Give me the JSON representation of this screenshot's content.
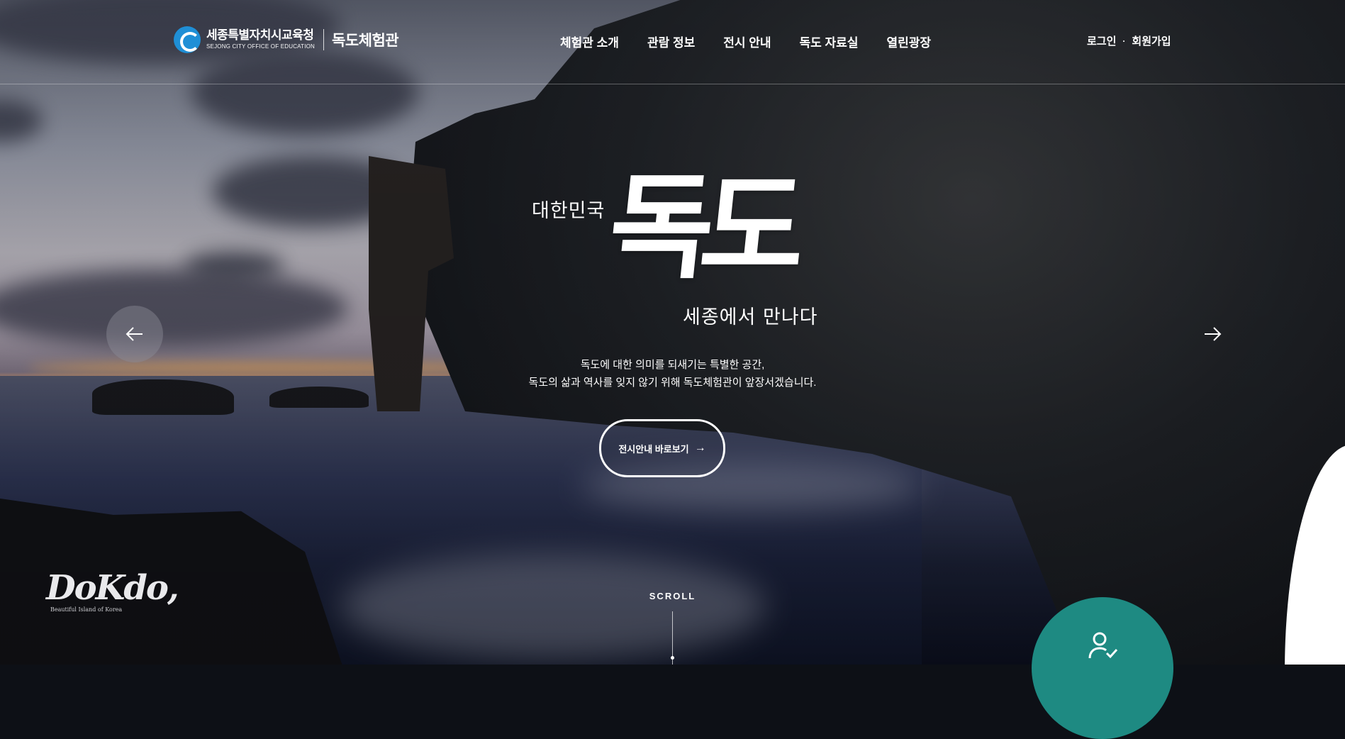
{
  "header": {
    "logo": {
      "org_name": "세종특별자치시교육청",
      "org_name_en": "SEJONG CITY OFFICE OF EDUCATION",
      "site_name": "독도체험관"
    },
    "nav": [
      {
        "label": "체험관 소개"
      },
      {
        "label": "관람 정보"
      },
      {
        "label": "전시 안내"
      },
      {
        "label": "독도 자료실"
      },
      {
        "label": "열린광장"
      }
    ],
    "util": {
      "login": "로그인",
      "separator": "·",
      "signup": "회원가입"
    }
  },
  "hero": {
    "pre_title": "대한민국",
    "title": "독도",
    "sub_title": "세종에서 만나다",
    "desc_line1": "독도에 대한 의미를 되새기는 특별한 공간,",
    "desc_line2": "독도의 삶과 역사를 잊지 않기 위해 독도체험관이 앞장서겠습니다.",
    "cta_label": "전시안내 바로보기",
    "cta_arrow": "→"
  },
  "slider": {
    "prev_icon": "arrow-left-icon",
    "next_icon": "arrow-right-icon"
  },
  "brand": {
    "script": "DoKdo,",
    "tagline": "Beautiful Island of Korea"
  },
  "scroll": {
    "label": "SCROLL"
  },
  "quick_button": {
    "icon": "user-check-icon",
    "color": "#1e8a82"
  }
}
